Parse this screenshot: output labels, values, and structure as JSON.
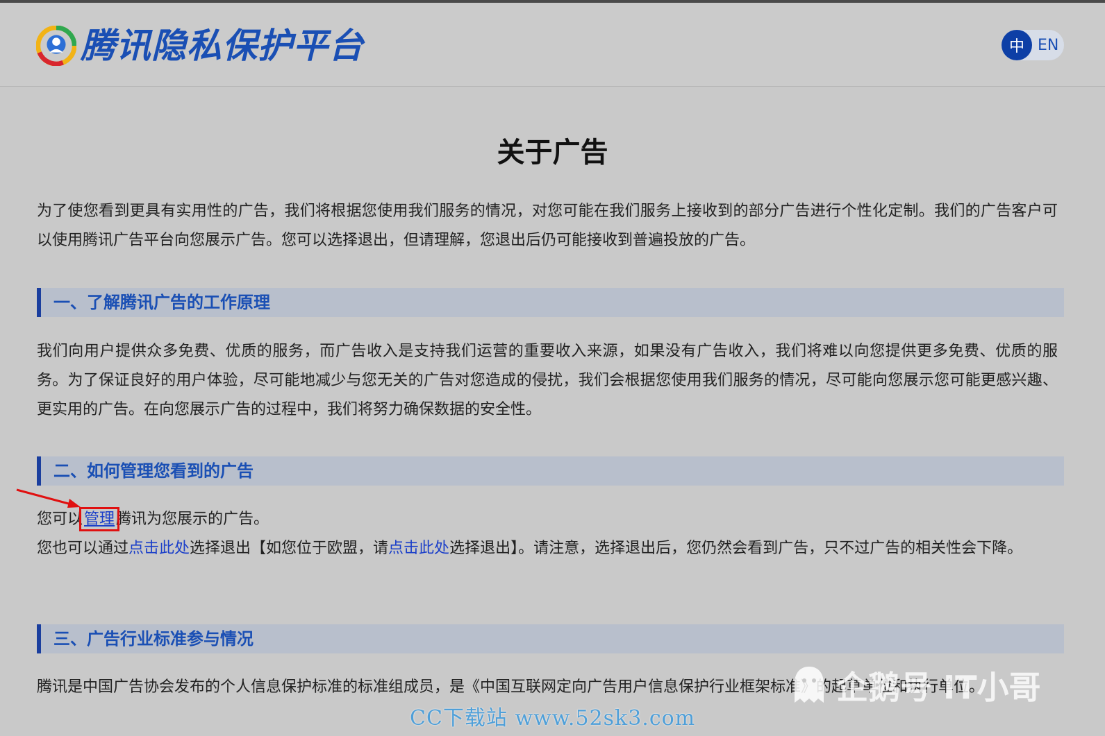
{
  "header": {
    "site_name": "腾讯隐私保护平台",
    "lang_zh": "中",
    "lang_en": "EN"
  },
  "page": {
    "title": "关于广告",
    "intro": "为了使您看到更具有实用性的广告，我们将根据您使用我们服务的情况，对您可能在我们服务上接收到的部分广告进行个性化定制。我们的广告客户可以使用腾讯广告平台向您展示广告。您可以选择退出，但请理解，您退出后仍可能接收到普遍投放的广告。"
  },
  "sections": [
    {
      "title": "一、了解腾讯广告的工作原理",
      "body": "我们向用户提供众多免费、优质的服务，而广告收入是支持我们运营的重要收入来源，如果没有广告收入，我们将难以向您提供更多免费、优质的服务。为了保证良好的用户体验，尽可能地减少与您无关的广告对您造成的侵扰，我们会根据您使用我们服务的情况，尽可能向您展示您可能更感兴趣、更实用的广告。在向您展示广告的过程中，我们将努力确保数据的安全性。"
    },
    {
      "title": "二、如何管理您看到的广告",
      "line1_prefix": "您可以",
      "line1_link": "管理",
      "line1_suffix": "腾讯为您展示的广告。",
      "line2_a": "您也可以通过",
      "line2_link1": "点击此处",
      "line2_b": "选择退出【如您位于欧盟，请",
      "line2_link2": "点击此处",
      "line2_c": "选择退出】。请注意，选择退出后，您仍然会看到广告，只不过广告的相关性会下降。"
    },
    {
      "title": "三、广告行业标准参与情况",
      "body": "腾讯是中国广告协会发布的个人信息保护标准的标准组成员，是《中国互联网定向广告用户信息保护行业框架标准》的起草单位和执行单位。"
    }
  ],
  "watermarks": {
    "wechat": "企鹅号 IT小哥",
    "site": "CC下载站 www.52sk3.com"
  },
  "colors": {
    "accent": "#1a4fb4",
    "section_bar": "#b8bfcc",
    "link": "#1b3fc9",
    "highlight_box": "#e01010"
  }
}
